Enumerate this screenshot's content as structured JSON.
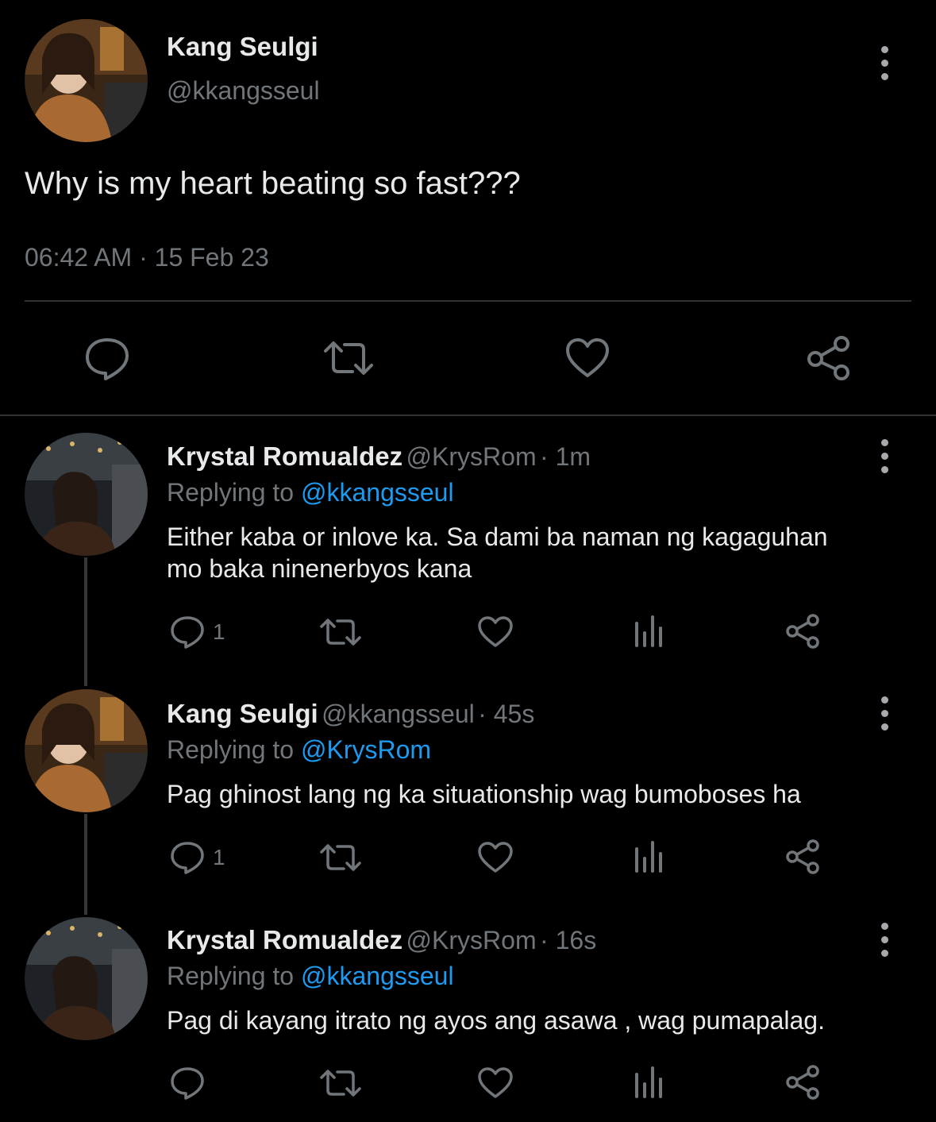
{
  "main_tweet": {
    "author_name": "Kang Seulgi",
    "author_handle": "@kkangsseul",
    "text": "Why is my heart beating so fast???",
    "timestamp": "06:42 AM · 15 Feb 23",
    "actions": [
      "reply-icon",
      "retweet-icon",
      "like-icon",
      "share-icon"
    ]
  },
  "replies": [
    {
      "author_name": "Krystal Romualdez",
      "author_handle": "@KrysRom",
      "time": "· 1m",
      "replying_prefix": "Replying to ",
      "replying_to": "@kkangsseul",
      "text_line1": "Either kaba or inlove ka. Sa dami ba naman ng kagaguhan",
      "text_line2": "mo baka ninenerbyos kana",
      "reply_count": "1"
    },
    {
      "author_name": "Kang Seulgi",
      "author_handle": "@kkangsseul",
      "time": "· 45s",
      "replying_prefix": "Replying to ",
      "replying_to": "@KrysRom",
      "text_line1": "Pag ghinost lang ng ka situationship wag bumoboses ha",
      "reply_count": "1"
    },
    {
      "author_name": "Krystal Romualdez",
      "author_handle": "@KrysRom",
      "time": "· 16s",
      "replying_prefix": "Replying to ",
      "replying_to": "@kkangsseul",
      "text_line1": "Pag di kayang itrato ng ayos ang asawa , wag pumapalag.",
      "reply_count": ""
    }
  ],
  "colors": {
    "background": "#000000",
    "text": "#e7e9ea",
    "muted": "#71767b",
    "link": "#1d9bf0",
    "divider": "#2f3336"
  }
}
